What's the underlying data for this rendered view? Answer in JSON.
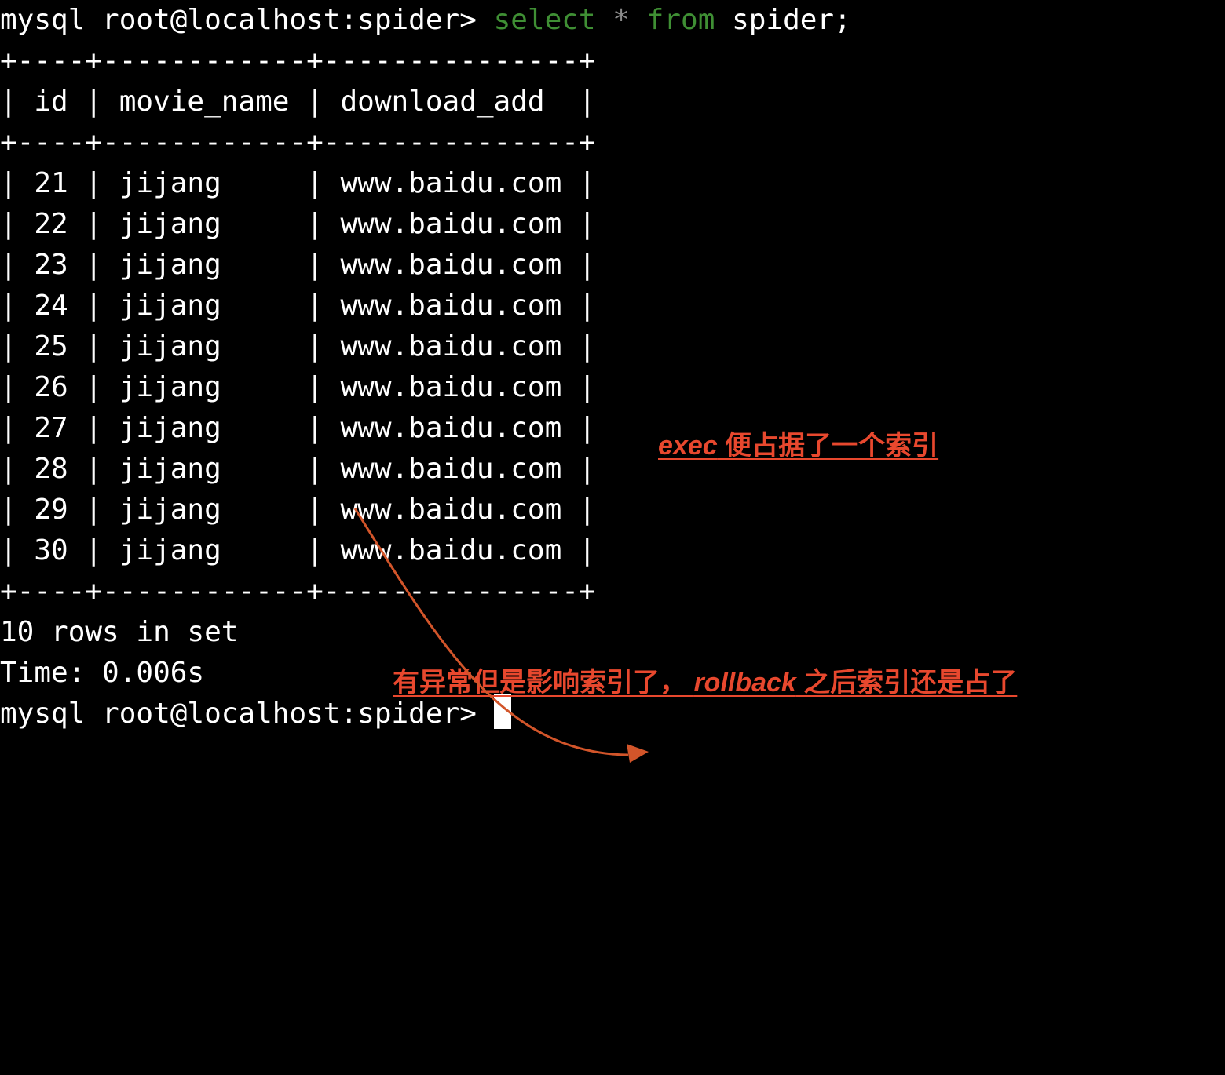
{
  "terminal": {
    "prompt": "mysql root@localhost:spider>",
    "command": {
      "kw_select": "select",
      "star": "*",
      "kw_from": "from",
      "rest": "spider;"
    },
    "table": {
      "border": "+----+------------+---------------+",
      "columns": [
        "id",
        "movie_name",
        "download_add"
      ],
      "rows": [
        [
          "21",
          "jijang",
          "www.baidu.com"
        ],
        [
          "22",
          "jijang",
          "www.baidu.com"
        ],
        [
          "23",
          "jijang",
          "www.baidu.com"
        ],
        [
          "24",
          "jijang",
          "www.baidu.com"
        ],
        [
          "25",
          "jijang",
          "www.baidu.com"
        ],
        [
          "26",
          "jijang",
          "www.baidu.com"
        ],
        [
          "27",
          "jijang",
          "www.baidu.com"
        ],
        [
          "28",
          "jijang",
          "www.baidu.com"
        ],
        [
          "29",
          "jijang",
          "www.baidu.com"
        ],
        [
          "30",
          "jijang",
          "www.baidu.com"
        ]
      ]
    },
    "summary": "10 rows in set",
    "time": "Time: 0.006s"
  },
  "annotations": {
    "note1": {
      "italic": "exec",
      "text": " 便占据了一个索引"
    },
    "note2": {
      "text_a": "有异常但是影响索引了，",
      "italic": "rollback",
      "text_b": " 之后索引还是占了"
    }
  },
  "colors": {
    "background": "#000000",
    "text": "#ffffff",
    "keyword": "#3f8f34",
    "operator": "#8a8a8a",
    "annotation": "#e8482e",
    "arrow": "#d2552a"
  }
}
